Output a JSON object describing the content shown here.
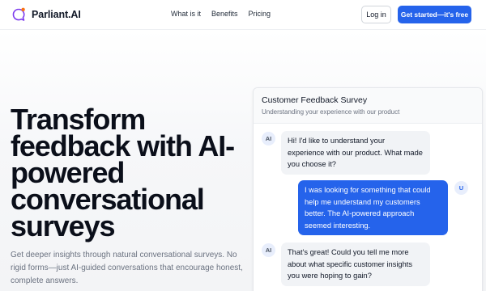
{
  "header": {
    "brand": "Parliant.AI",
    "nav": [
      "What is it",
      "Benefits",
      "Pricing"
    ],
    "login_label": "Log in",
    "cta_label": "Get started—it's free"
  },
  "hero": {
    "title_lines": [
      "Transform",
      "feedback with AI-",
      "powered",
      "conversational",
      "surveys"
    ],
    "subtitle": "Get deeper insights through natural conversational surveys. No rigid forms—just AI-guided conversations that encourage honest, complete answers."
  },
  "survey": {
    "title": "Customer Feedback Survey",
    "subtitle": "Understanding your experience with our product",
    "messages": [
      {
        "from": "AI",
        "avatar": "AI",
        "text": "Hi! I'd like to understand your experience with our product. What made you choose it?"
      },
      {
        "from": "User",
        "avatar": "U",
        "text": "I was looking for something that could help me understand my customers better. The AI-powered approach seemed interesting."
      },
      {
        "from": "AI",
        "avatar": "AI",
        "text": "That's great! Could you tell me more about what specific customer insights you were hoping to gain?"
      }
    ]
  },
  "colors": {
    "accent": "#2563eb",
    "logo_purple": "#7c3aed",
    "logo_orange": "#f97316"
  }
}
